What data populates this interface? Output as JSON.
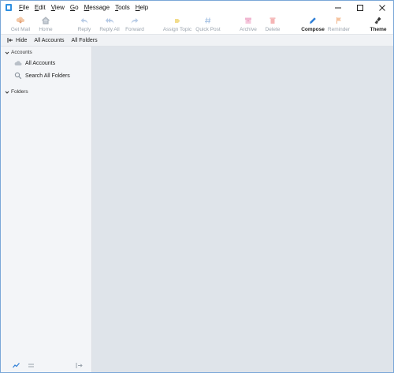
{
  "menu": {
    "items": [
      {
        "label": "File",
        "accel": "F",
        "rest": "ile"
      },
      {
        "label": "Edit",
        "accel": "E",
        "rest": "dit"
      },
      {
        "label": "View",
        "accel": "V",
        "rest": "iew"
      },
      {
        "label": "Go",
        "accel": "G",
        "rest": "o"
      },
      {
        "label": "Message",
        "accel": "M",
        "rest": "essage"
      },
      {
        "label": "Tools",
        "accel": "T",
        "rest": "ools"
      },
      {
        "label": "Help",
        "accel": "H",
        "rest": "elp"
      }
    ]
  },
  "toolbar": {
    "get_mail": "Get Mail",
    "home": "Home",
    "reply": "Reply",
    "reply_all": "Reply All",
    "forward": "Forward",
    "assign_topic": "Assign Topic",
    "quick_post": "Quick Post",
    "archive": "Archive",
    "delete": "Delete",
    "compose": "Compose",
    "reminder": "Reminder",
    "theme": "Theme"
  },
  "subbar": {
    "hide": "Hide",
    "all_accounts": "All Accounts",
    "all_folders": "All Folders"
  },
  "sidebar": {
    "accounts_header": "Accounts",
    "all_accounts": "All Accounts",
    "search_all_folders": "Search All Folders",
    "folders_header": "Folders"
  },
  "colors": {
    "accent": "#2f7fd6",
    "main_bg": "#dfe4ea",
    "sidebar_bg": "#f3f5f8"
  }
}
